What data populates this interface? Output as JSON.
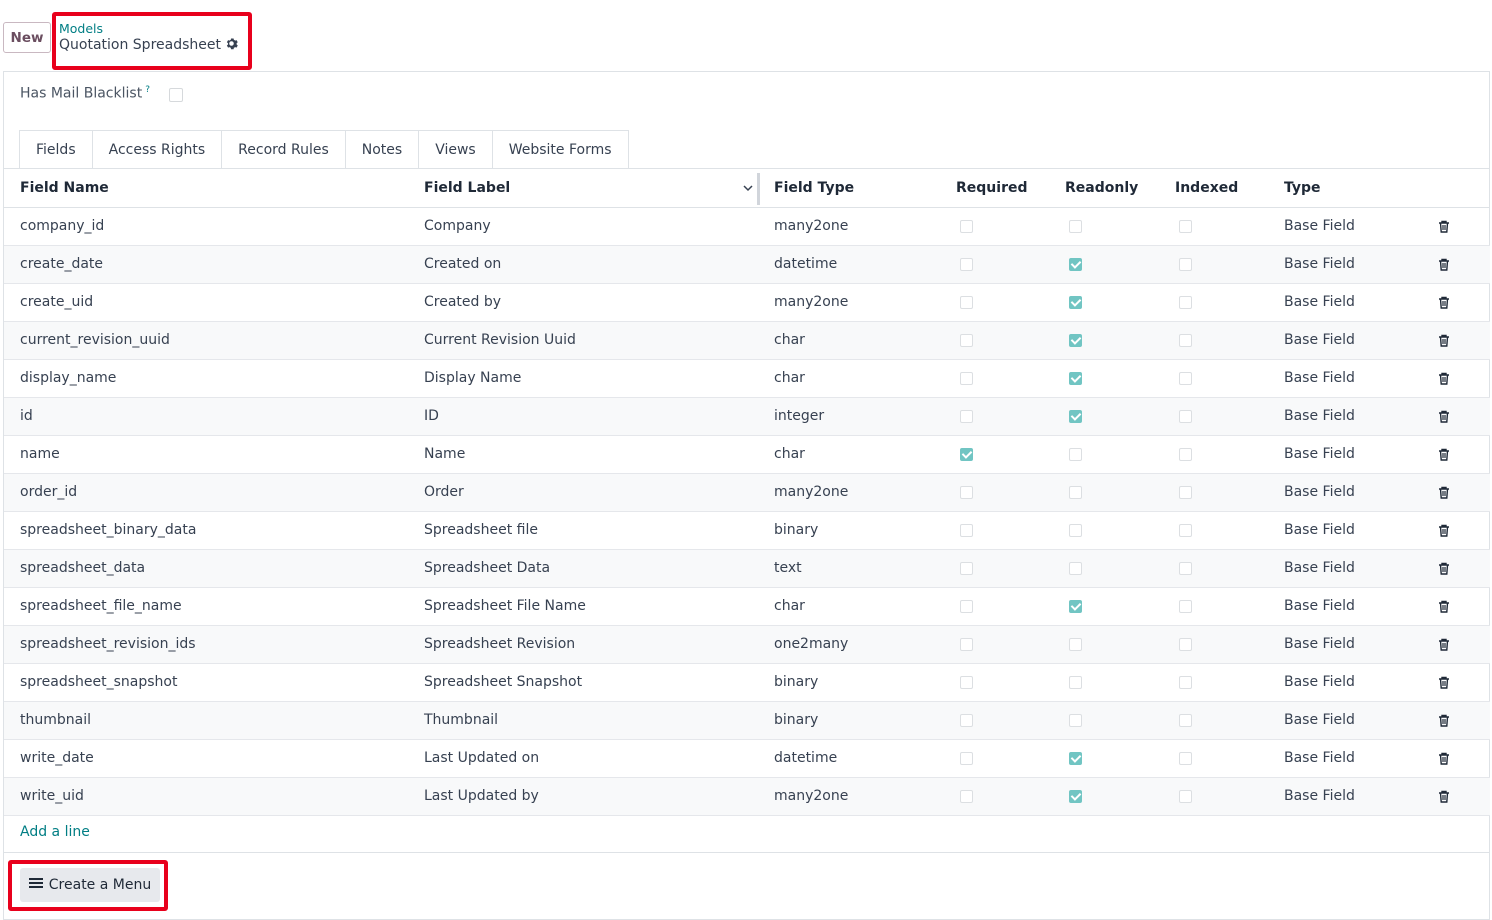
{
  "control_panel": {
    "new_label": "New",
    "breadcrumb_parent": "Models",
    "record_title": "Quotation Spreadsheet"
  },
  "form": {
    "has_mail_blacklist_label": "Has Mail Blacklist",
    "help_marker": "?",
    "has_mail_blacklist_checked": false
  },
  "tabs": [
    "Fields",
    "Access Rights",
    "Record Rules",
    "Notes",
    "Views",
    "Website Forms"
  ],
  "table": {
    "headers": [
      "Field Name",
      "Field Label",
      "Field Type",
      "Required",
      "Readonly",
      "Indexed",
      "Type"
    ],
    "rows": [
      {
        "name": "company_id",
        "label": "Company",
        "ftype": "many2one",
        "required": false,
        "readonly": false,
        "indexed": false,
        "type": "Base Field"
      },
      {
        "name": "create_date",
        "label": "Created on",
        "ftype": "datetime",
        "required": false,
        "readonly": true,
        "indexed": false,
        "type": "Base Field"
      },
      {
        "name": "create_uid",
        "label": "Created by",
        "ftype": "many2one",
        "required": false,
        "readonly": true,
        "indexed": false,
        "type": "Base Field"
      },
      {
        "name": "current_revision_uuid",
        "label": "Current Revision Uuid",
        "ftype": "char",
        "required": false,
        "readonly": true,
        "indexed": false,
        "type": "Base Field"
      },
      {
        "name": "display_name",
        "label": "Display Name",
        "ftype": "char",
        "required": false,
        "readonly": true,
        "indexed": false,
        "type": "Base Field"
      },
      {
        "name": "id",
        "label": "ID",
        "ftype": "integer",
        "required": false,
        "readonly": true,
        "indexed": false,
        "type": "Base Field"
      },
      {
        "name": "name",
        "label": "Name",
        "ftype": "char",
        "required": true,
        "readonly": false,
        "indexed": false,
        "type": "Base Field"
      },
      {
        "name": "order_id",
        "label": "Order",
        "ftype": "many2one",
        "required": false,
        "readonly": false,
        "indexed": false,
        "type": "Base Field"
      },
      {
        "name": "spreadsheet_binary_data",
        "label": "Spreadsheet file",
        "ftype": "binary",
        "required": false,
        "readonly": false,
        "indexed": false,
        "type": "Base Field"
      },
      {
        "name": "spreadsheet_data",
        "label": "Spreadsheet Data",
        "ftype": "text",
        "required": false,
        "readonly": false,
        "indexed": false,
        "type": "Base Field"
      },
      {
        "name": "spreadsheet_file_name",
        "label": "Spreadsheet File Name",
        "ftype": "char",
        "required": false,
        "readonly": true,
        "indexed": false,
        "type": "Base Field"
      },
      {
        "name": "spreadsheet_revision_ids",
        "label": "Spreadsheet Revision",
        "ftype": "one2many",
        "required": false,
        "readonly": false,
        "indexed": false,
        "type": "Base Field"
      },
      {
        "name": "spreadsheet_snapshot",
        "label": "Spreadsheet Snapshot",
        "ftype": "binary",
        "required": false,
        "readonly": false,
        "indexed": false,
        "type": "Base Field"
      },
      {
        "name": "thumbnail",
        "label": "Thumbnail",
        "ftype": "binary",
        "required": false,
        "readonly": false,
        "indexed": false,
        "type": "Base Field"
      },
      {
        "name": "write_date",
        "label": "Last Updated on",
        "ftype": "datetime",
        "required": false,
        "readonly": true,
        "indexed": false,
        "type": "Base Field"
      },
      {
        "name": "write_uid",
        "label": "Last Updated by",
        "ftype": "many2one",
        "required": false,
        "readonly": true,
        "indexed": false,
        "type": "Base Field"
      }
    ],
    "add_line_label": "Add a line"
  },
  "footer": {
    "create_menu_label": "Create a Menu"
  },
  "colors": {
    "accent": "#017e84",
    "highlight": "#e8001c",
    "checked": "#71c5c3"
  },
  "icons": [
    "gear-icon",
    "chevron-down-icon",
    "trash-icon",
    "hamburger-icon"
  ]
}
